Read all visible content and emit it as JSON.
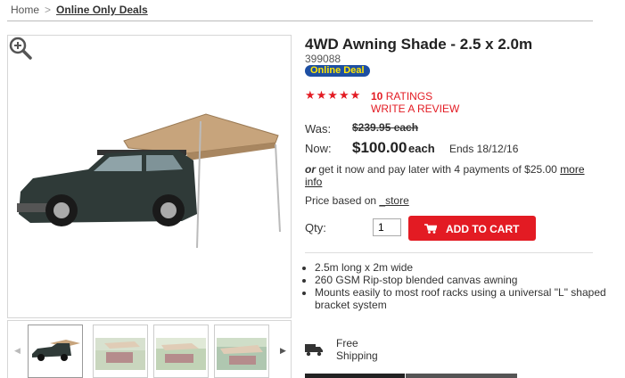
{
  "breadcrumb": {
    "home": "Home",
    "separator": ">",
    "current": "Online Only Deals"
  },
  "product": {
    "title": "4WD Awning Shade - 2.5 x 2.0m",
    "sku": "399088",
    "badge": "Online Deal",
    "stars_display": "★★★★★",
    "rating_value": 5,
    "ratings_count": "10",
    "ratings_label": "RATINGS",
    "write_review": "WRITE A REVIEW",
    "was_label": "Was:",
    "was_price": "$239.95 each",
    "now_label": "Now:",
    "now_price": "$100.00",
    "each": "each",
    "ends": "Ends 18/12/16",
    "payment_or": "or",
    "payment_text": "get it now and pay later with 4 payments of $25.00",
    "payment_link": "more info",
    "store_text": "Price based on",
    "store_link": "_store",
    "qty_label": "Qty:",
    "qty_value": "1",
    "add_to_cart": "ADD TO CART",
    "features": [
      "2.5m long x 2m wide",
      "260 GSM Rip-stop blended canvas awning",
      "Mounts easily to most roof racks using a universal \"L\" shaped bracket system"
    ],
    "shipping_line1": "Free",
    "shipping_line2": "Shipping"
  },
  "icons": {
    "zoom": "zoom-in-icon",
    "cart": "cart-icon",
    "truck": "truck-icon",
    "prev": "chevron-left-icon",
    "next": "chevron-right-icon"
  },
  "colors": {
    "accent": "#e31b23",
    "badge_bg": "#1d4fa3",
    "badge_text": "#ffe600"
  }
}
